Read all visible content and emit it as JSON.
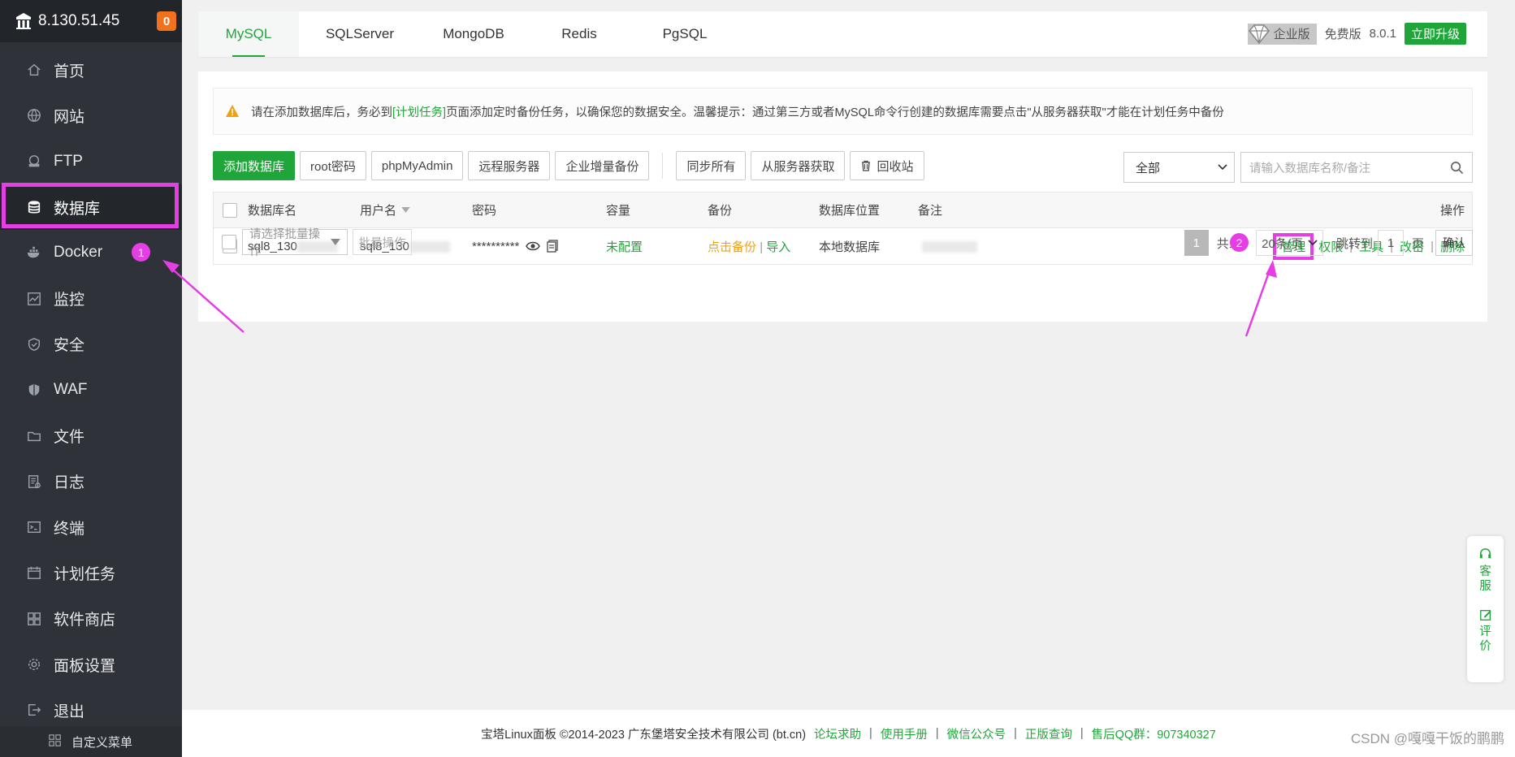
{
  "sidebar": {
    "server_ip": "8.130.51.45",
    "notification_count": "0",
    "items": [
      {
        "label": "首页",
        "icon": "home-icon"
      },
      {
        "label": "网站",
        "icon": "globe-icon"
      },
      {
        "label": "FTP",
        "icon": "ftp-icon"
      },
      {
        "label": "数据库",
        "icon": "database-icon"
      },
      {
        "label": "Docker",
        "icon": "docker-icon"
      },
      {
        "label": "监控",
        "icon": "monitor-icon"
      },
      {
        "label": "安全",
        "icon": "shield-icon"
      },
      {
        "label": "WAF",
        "icon": "waf-icon"
      },
      {
        "label": "文件",
        "icon": "folder-icon"
      },
      {
        "label": "日志",
        "icon": "log-icon"
      },
      {
        "label": "终端",
        "icon": "terminal-icon"
      },
      {
        "label": "计划任务",
        "icon": "calendar-icon"
      },
      {
        "label": "软件商店",
        "icon": "apps-icon"
      },
      {
        "label": "面板设置",
        "icon": "gear-icon"
      },
      {
        "label": "退出",
        "icon": "logout-icon"
      }
    ],
    "active_item": "数据库",
    "custom_menu_label": "自定义菜单"
  },
  "tabs": [
    "MySQL",
    "SQLServer",
    "MongoDB",
    "Redis",
    "PgSQL"
  ],
  "active_tab": "MySQL",
  "version": {
    "enterprise_label": "企业版",
    "free_label": "免费版",
    "number": "8.0.1",
    "upgrade_label": "立即升级"
  },
  "notice": {
    "prefix": "请在添加数据库后，务必到",
    "link": "[计划任务]",
    "suffix": "页面添加定时备份任务，以确保您的数据安全。温馨提示：通过第三方或者MySQL命令行创建的数据库需要点击\"从服务器获取\"才能在计划任务中备份"
  },
  "toolbar": {
    "add_db": "添加数据库",
    "root_pwd": "root密码",
    "phpmyadmin": "phpMyAdmin",
    "remote_server": "远程服务器",
    "enterprise_backup": "企业增量备份",
    "sync_all": "同步所有",
    "fetch_from_server": "从服务器获取",
    "recycle_bin": "回收站"
  },
  "filter": {
    "selected": "全部"
  },
  "search": {
    "placeholder": "请输入数据库名称/备注"
  },
  "table": {
    "headers": {
      "name": "数据库名",
      "user": "用户名",
      "password": "密码",
      "capacity": "容量",
      "backup": "备份",
      "location": "数据库位置",
      "remark": "备注",
      "actions": "操作"
    },
    "rows": [
      {
        "name": "sql8_130",
        "user": "sql8_130",
        "password": "**********",
        "capacity": "未配置",
        "backup_click": "点击备份",
        "backup_sep": "|",
        "backup_import": "导入",
        "location": "本地数据库",
        "actions": {
          "manage": "管理",
          "permissions": "权限",
          "tools": "工具",
          "change_pwd": "改密",
          "delete": "删除"
        }
      }
    ]
  },
  "batch": {
    "select_placeholder": "请选择批量操作",
    "button": "批量操作"
  },
  "pagination": {
    "current": "1",
    "total": "共1条",
    "page_size": "20条/页",
    "jump_label": "跳转到",
    "jump_value": "1",
    "unit": "页",
    "confirm": "确认"
  },
  "footer": {
    "copyright": "宝塔Linux面板 ©2014-2023 广东堡塔安全技术有限公司 (bt.cn)",
    "links": [
      "论坛求助",
      "使用手册",
      "微信公众号",
      "正版查询",
      "售后QQ群：907340327"
    ]
  },
  "float_panel": {
    "service": "客服",
    "review": "评价"
  },
  "markers": {
    "first": "1",
    "second": "2"
  },
  "watermark": "CSDN @嘎嘎干饭的鹏鹏",
  "colors": {
    "accent": "#20a53a",
    "sidebar_bg": "#2f3339",
    "annotation": "#e53ee5",
    "warning": "#f0a10d"
  }
}
